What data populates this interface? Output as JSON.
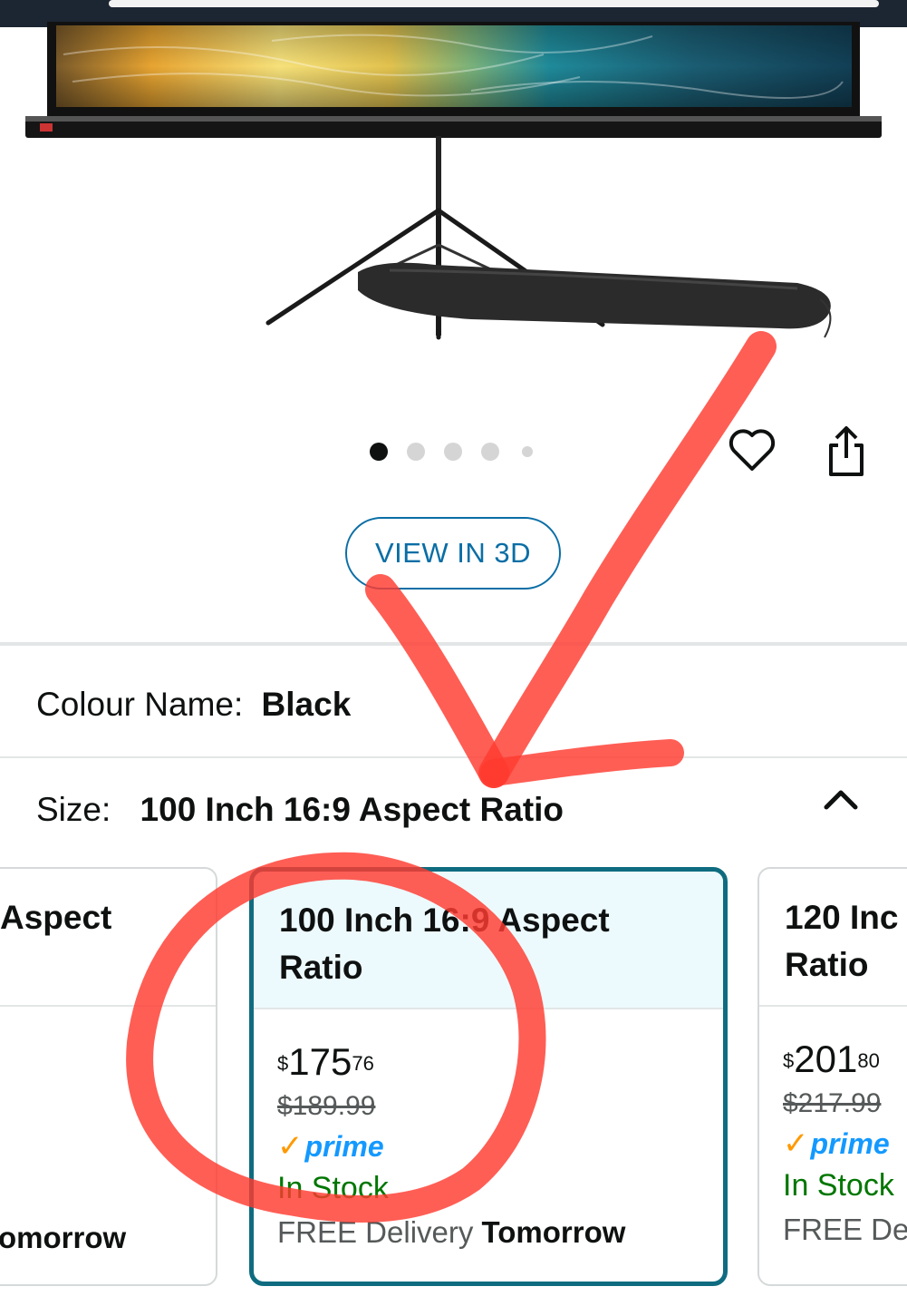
{
  "carousel": {
    "total": 5,
    "active_index": 0
  },
  "view_3d_label": "VIEW IN 3D",
  "colour": {
    "label": "Colour Name:",
    "value": "Black"
  },
  "size": {
    "label": "Size:",
    "value": "100 Inch 16:9 Aspect Ratio"
  },
  "size_options": [
    {
      "title": "Aspect",
      "delivery_day": "omorrow"
    },
    {
      "title_line1": "100 Inch 16:9 Aspect",
      "title_line2": "Ratio",
      "price_symbol": "$",
      "price_whole": "175",
      "price_fraction": "76",
      "list_price": "$189.99",
      "prime": "prime",
      "availability": "In Stock",
      "delivery_prefix": "FREE Delivery",
      "delivery_day": "Tomorrow",
      "selected": true
    },
    {
      "title_line1": "120 Inc",
      "title_line2": "Ratio",
      "price_symbol": "$",
      "price_whole": "201",
      "price_fraction": "80",
      "list_price": "$217.99",
      "prime": "prime",
      "availability": "In Stock",
      "delivery_prefix": "FREE Del"
    }
  ],
  "colors": {
    "link_blue": "#0a6ea5",
    "selected_border": "#0f6c80",
    "in_stock_green": "#007600",
    "prime_blue": "#1399ff",
    "prime_check": "#ff9900",
    "annotation_red": "#ff3b30"
  }
}
